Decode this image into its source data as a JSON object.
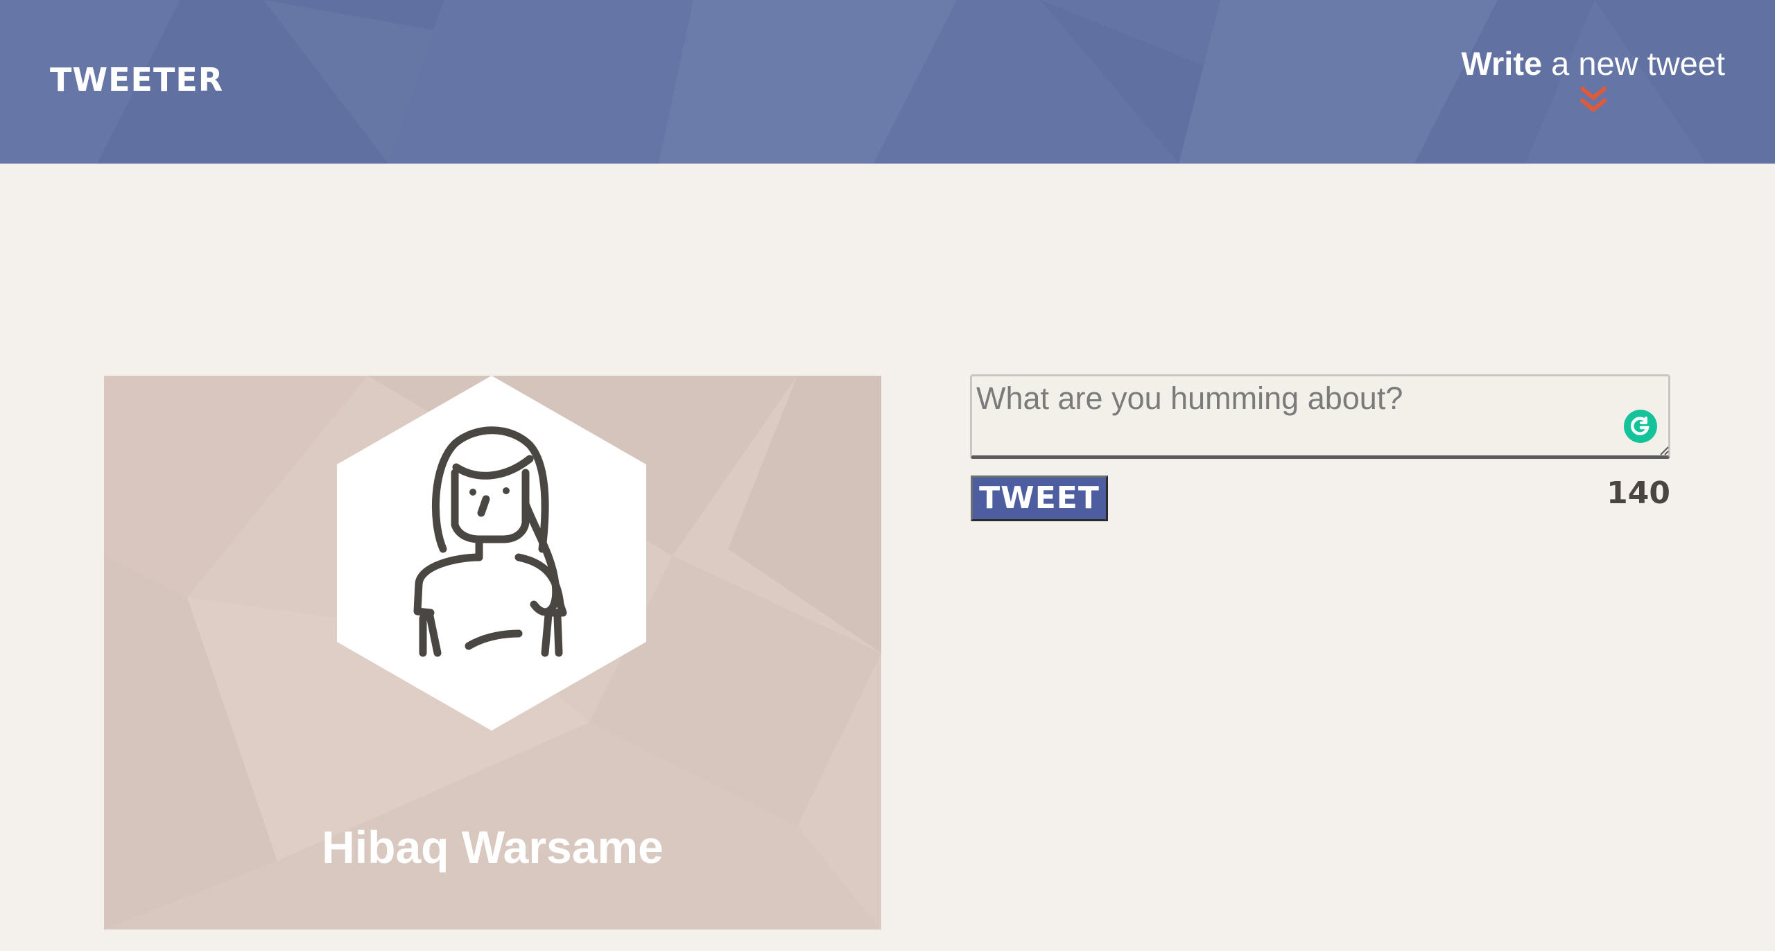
{
  "nav": {
    "brand": "TWEETER",
    "compose": {
      "strong": "Write",
      "rest": " a new tweet",
      "icon": "double-chevron-down-icon"
    }
  },
  "profile": {
    "name": "Hibaq Warsame",
    "avatar_icon": "woman-avatar-icon"
  },
  "composer": {
    "value": "",
    "placeholder": "What are you humming about?",
    "button_label": "TWEET",
    "counter": "140",
    "extension_icon": "grammarly-icon"
  },
  "colors": {
    "nav_bg": "#6374a4",
    "page_bg": "#f4f1ec",
    "card_bg": "#dccbc3",
    "accent_arrow": "#e05a3a",
    "button_bg": "#4d5ea0",
    "grammarly": "#15c39a"
  }
}
